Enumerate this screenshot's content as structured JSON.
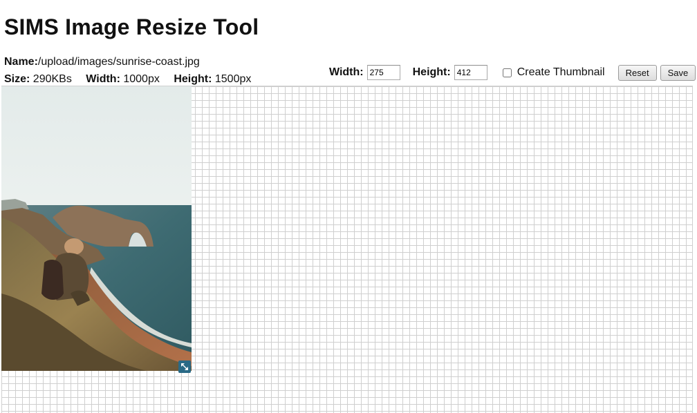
{
  "header": {
    "title": "SIMS Image Resize Tool"
  },
  "file_info": {
    "name_label": "Name:",
    "name_value": "/upload/images/sunrise-coast.jpg",
    "size_label": "Size:",
    "size_value": "290KBs",
    "width_label": "Width:",
    "width_value": "1000px",
    "height_label": "Height:",
    "height_value": "1500px"
  },
  "controls": {
    "width_label": "Width:",
    "width_value": "275",
    "height_label": "Height:",
    "height_value": "412",
    "thumbnail_label": "Create Thumbnail",
    "thumbnail_checked": false,
    "reset_label": "Reset",
    "save_label": "Save"
  },
  "canvas": {
    "image_alt": "Person sitting on grassy cliff overlooking a rock arch and beach at sunrise",
    "resize_handle_icon": "resize-arrows-icon",
    "handle_color": "#2a6a86",
    "grid_color": "#cfcfcf"
  }
}
